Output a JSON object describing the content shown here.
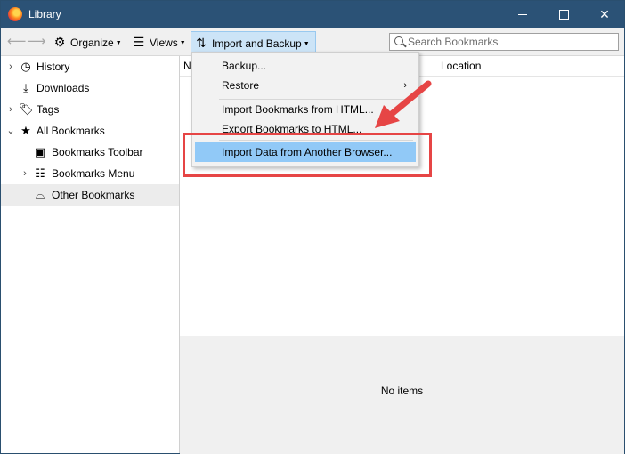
{
  "window": {
    "title": "Library"
  },
  "toolbar": {
    "back_icon": "arrow-left-icon",
    "forward_icon": "arrow-right-icon",
    "organize_label": "Organize",
    "views_label": "Views",
    "import_label": "Import and Backup",
    "search_placeholder": "Search Bookmarks"
  },
  "sidebar": {
    "items": [
      {
        "label": "History",
        "icon": "clock-icon"
      },
      {
        "label": "Downloads",
        "icon": "download-icon"
      },
      {
        "label": "Tags",
        "icon": "tag-icon"
      },
      {
        "label": "All Bookmarks",
        "icon": "star-icon"
      },
      {
        "label": "Bookmarks Toolbar",
        "icon": "bookmark-toolbar-icon"
      },
      {
        "label": "Bookmarks Menu",
        "icon": "bookmark-menu-icon"
      },
      {
        "label": "Other Bookmarks",
        "icon": "folder-tray-icon"
      }
    ]
  },
  "columns": {
    "name": "N",
    "location": "Location"
  },
  "detail": {
    "empty_text": "No items"
  },
  "menu": {
    "items": [
      {
        "label": "Backup..."
      },
      {
        "label": "Restore"
      },
      {
        "label": "Import Bookmarks from HTML..."
      },
      {
        "label": "Export Bookmarks to HTML..."
      },
      {
        "label": "Import Data from Another Browser..."
      }
    ]
  },
  "colors": {
    "titlebar": "#2b5276",
    "menu_highlight": "#91c9f7",
    "annotation_red": "#e64545"
  }
}
